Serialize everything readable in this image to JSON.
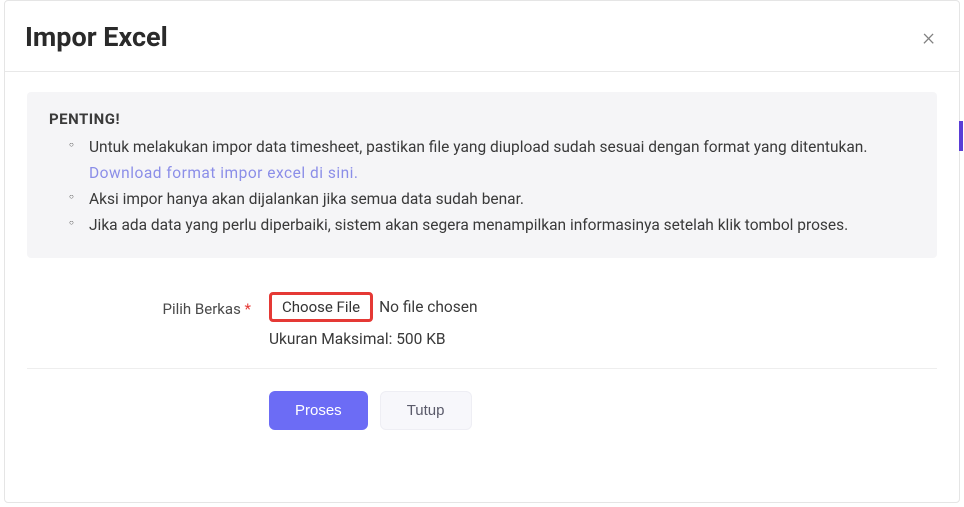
{
  "modal": {
    "title": "Impor Excel",
    "close_label": "×"
  },
  "alert": {
    "heading": "PENTING!",
    "items": [
      {
        "text_before": "Untuk melakukan impor data timesheet, pastikan file yang diupload sudah sesuai dengan format yang ditentukan. ",
        "link": "Download format impor excel di sini.",
        "text_after": ""
      },
      {
        "text_before": "Aksi impor hanya akan dijalankan jika semua data sudah benar.",
        "link": "",
        "text_after": ""
      },
      {
        "text_before": "Jika ada data yang perlu diperbaiki, sistem akan segera menampilkan informasinya setelah klik tombol proses.",
        "link": "",
        "text_after": ""
      }
    ]
  },
  "form": {
    "file_label": "Pilih Berkas ",
    "required_marker": "*",
    "choose_file_label": "Choose File",
    "file_status": "No file chosen",
    "file_hint": "Ukuran Maksimal: 500 KB"
  },
  "buttons": {
    "submit": "Proses",
    "cancel": "Tutup"
  }
}
